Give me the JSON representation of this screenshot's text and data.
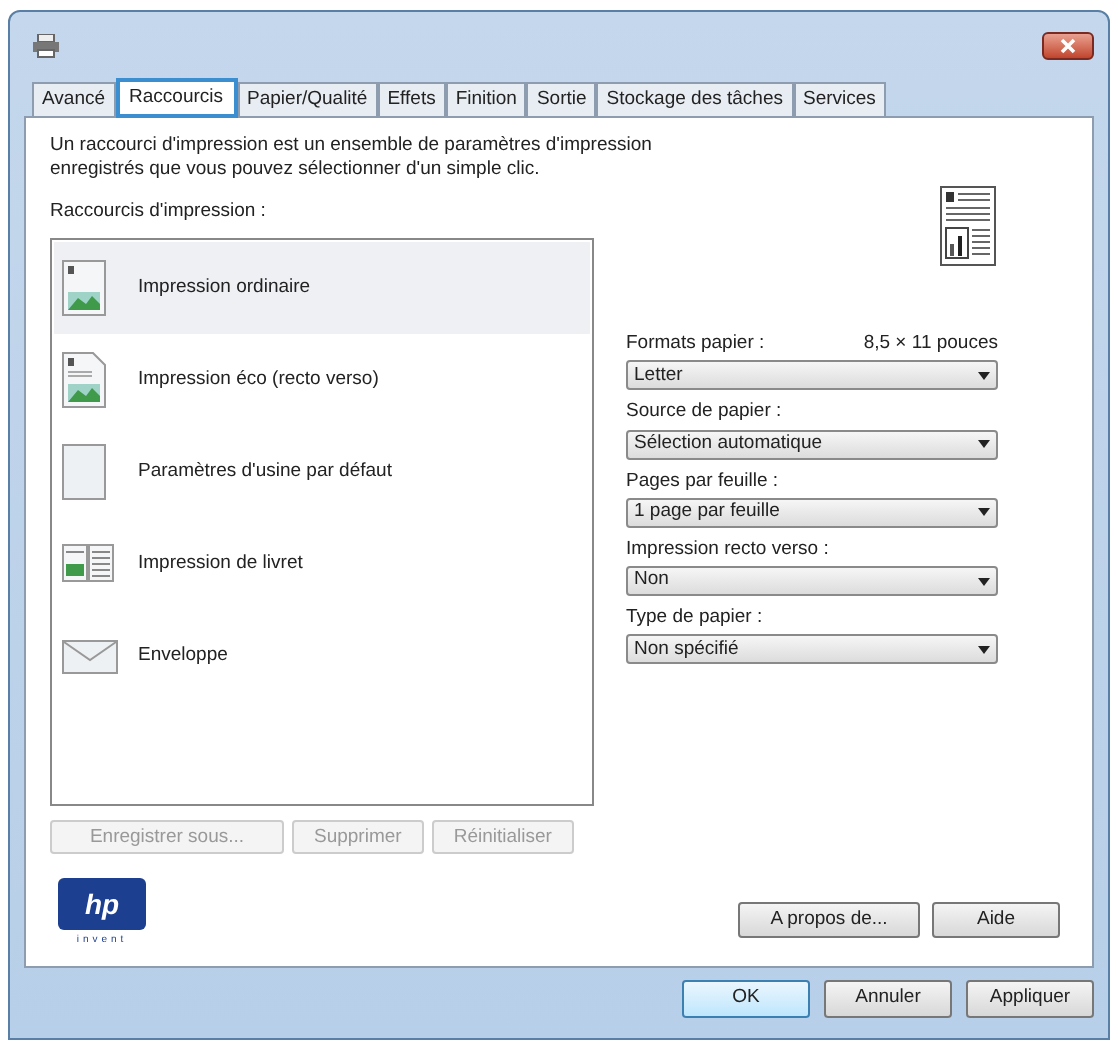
{
  "tabs": [
    {
      "label": "Avancé",
      "selected": false
    },
    {
      "label": "Raccourcis",
      "selected": true
    },
    {
      "label": "Papier/Qualité",
      "selected": false
    },
    {
      "label": "Effets",
      "selected": false
    },
    {
      "label": "Finition",
      "selected": false
    },
    {
      "label": "Sortie",
      "selected": false
    },
    {
      "label": "Stockage des tâches",
      "selected": false
    },
    {
      "label": "Services",
      "selected": false
    }
  ],
  "description": "Un raccourci d'impression est un ensemble de paramètres d'impression enregistrés que vous pouvez sélectionner d'un simple clic.",
  "shortcuts_label": "Raccourcis d'impression :",
  "shortcuts": [
    {
      "label": "Impression ordinaire",
      "kind": "standard",
      "selected": true
    },
    {
      "label": "Impression éco (recto verso)",
      "kind": "eco",
      "selected": false
    },
    {
      "label": "Paramètres d'usine par défaut",
      "kind": "blank",
      "selected": false
    },
    {
      "label": "Impression de livret",
      "kind": "booklet",
      "selected": false
    },
    {
      "label": "Enveloppe",
      "kind": "envelope",
      "selected": false
    }
  ],
  "list_buttons": [
    {
      "label": "Enregistrer sous...",
      "disabled": true
    },
    {
      "label": "Supprimer",
      "disabled": true
    },
    {
      "label": "Réinitialiser",
      "disabled": true
    }
  ],
  "paper_size_reading": "8,5 × 11 pouces",
  "settings": [
    {
      "label": "Formats papier :",
      "value": "Letter"
    },
    {
      "label": "Source de papier :",
      "value": "Sélection automatique"
    },
    {
      "label": "Pages par feuille :",
      "value": "1 page par feuille"
    },
    {
      "label": "Impression recto verso :",
      "value": "Non"
    },
    {
      "label": "Type de papier :",
      "value": "Non spécifié"
    }
  ],
  "logo": {
    "mark": "hp",
    "tagline": "invent"
  },
  "panel_buttons": [
    "A propos de...",
    "Aide"
  ],
  "dialog_buttons": [
    {
      "label": "OK",
      "default": true
    },
    {
      "label": "Annuler",
      "default": false
    },
    {
      "label": "Appliquer",
      "default": false
    }
  ]
}
